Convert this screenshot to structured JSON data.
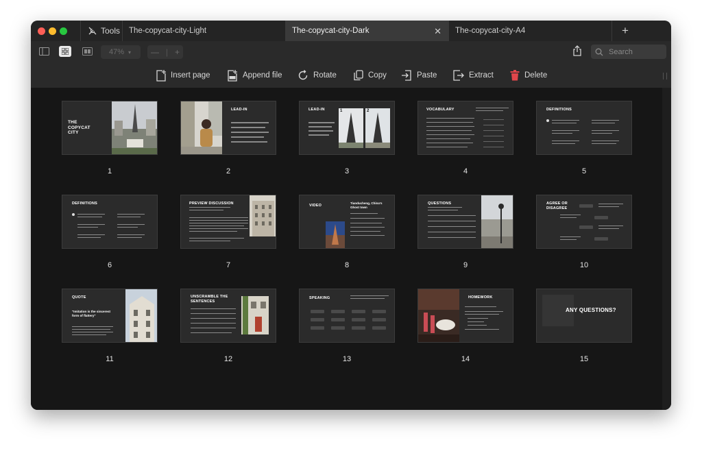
{
  "tabs": {
    "tools_label": "Tools",
    "items": [
      {
        "label": "The-copycat-city-Light"
      },
      {
        "label": "The-copycat-city-Dark"
      },
      {
        "label": "The-copycat-city-A4"
      }
    ],
    "new_tab": "+",
    "close": "✕"
  },
  "toolbar": {
    "zoom": "47%",
    "zoom_minus": "—",
    "zoom_plus": "+",
    "search_placeholder": "Search"
  },
  "actions": [
    {
      "label": "Insert page"
    },
    {
      "label": "Append file"
    },
    {
      "label": "Rotate"
    },
    {
      "label": "Copy"
    },
    {
      "label": "Paste"
    },
    {
      "label": "Extract"
    },
    {
      "label": "Delete"
    }
  ],
  "colors": {
    "delete_icon": "#e0464b",
    "active_tab": "#3a3a3a"
  },
  "slides": [
    {
      "page": "1",
      "title": "THE COPYCAT CITY"
    },
    {
      "page": "2",
      "title": "LEAD-IN"
    },
    {
      "page": "3",
      "title": "LEAD-IN"
    },
    {
      "page": "4",
      "title": "VOCABULARY"
    },
    {
      "page": "5",
      "title": "DEFINITIONS"
    },
    {
      "page": "6",
      "title": "DEFINITIONS"
    },
    {
      "page": "7",
      "title": "PREVIEW DISCUSSION"
    },
    {
      "page": "8",
      "title": "VIDEO"
    },
    {
      "page": "9",
      "title": "QUESTIONS"
    },
    {
      "page": "10",
      "title": "AGREE OR DISAGREE"
    },
    {
      "page": "11",
      "title": "QUOTE"
    },
    {
      "page": "12",
      "title": "UNSCRAMBLE THE SENTENCES"
    },
    {
      "page": "13",
      "title": "SPEAKING"
    },
    {
      "page": "14",
      "title": "HOMEWORK"
    },
    {
      "page": "15",
      "title": "ANY QUESTIONS?"
    }
  ],
  "slide_texts": {
    "s3_n1": "1",
    "s3_n2": "2",
    "s8_heading": "Tianducheng, China's Ghost town",
    "s11_quote": "\"Imitation is the sincerest form of flattery\""
  }
}
